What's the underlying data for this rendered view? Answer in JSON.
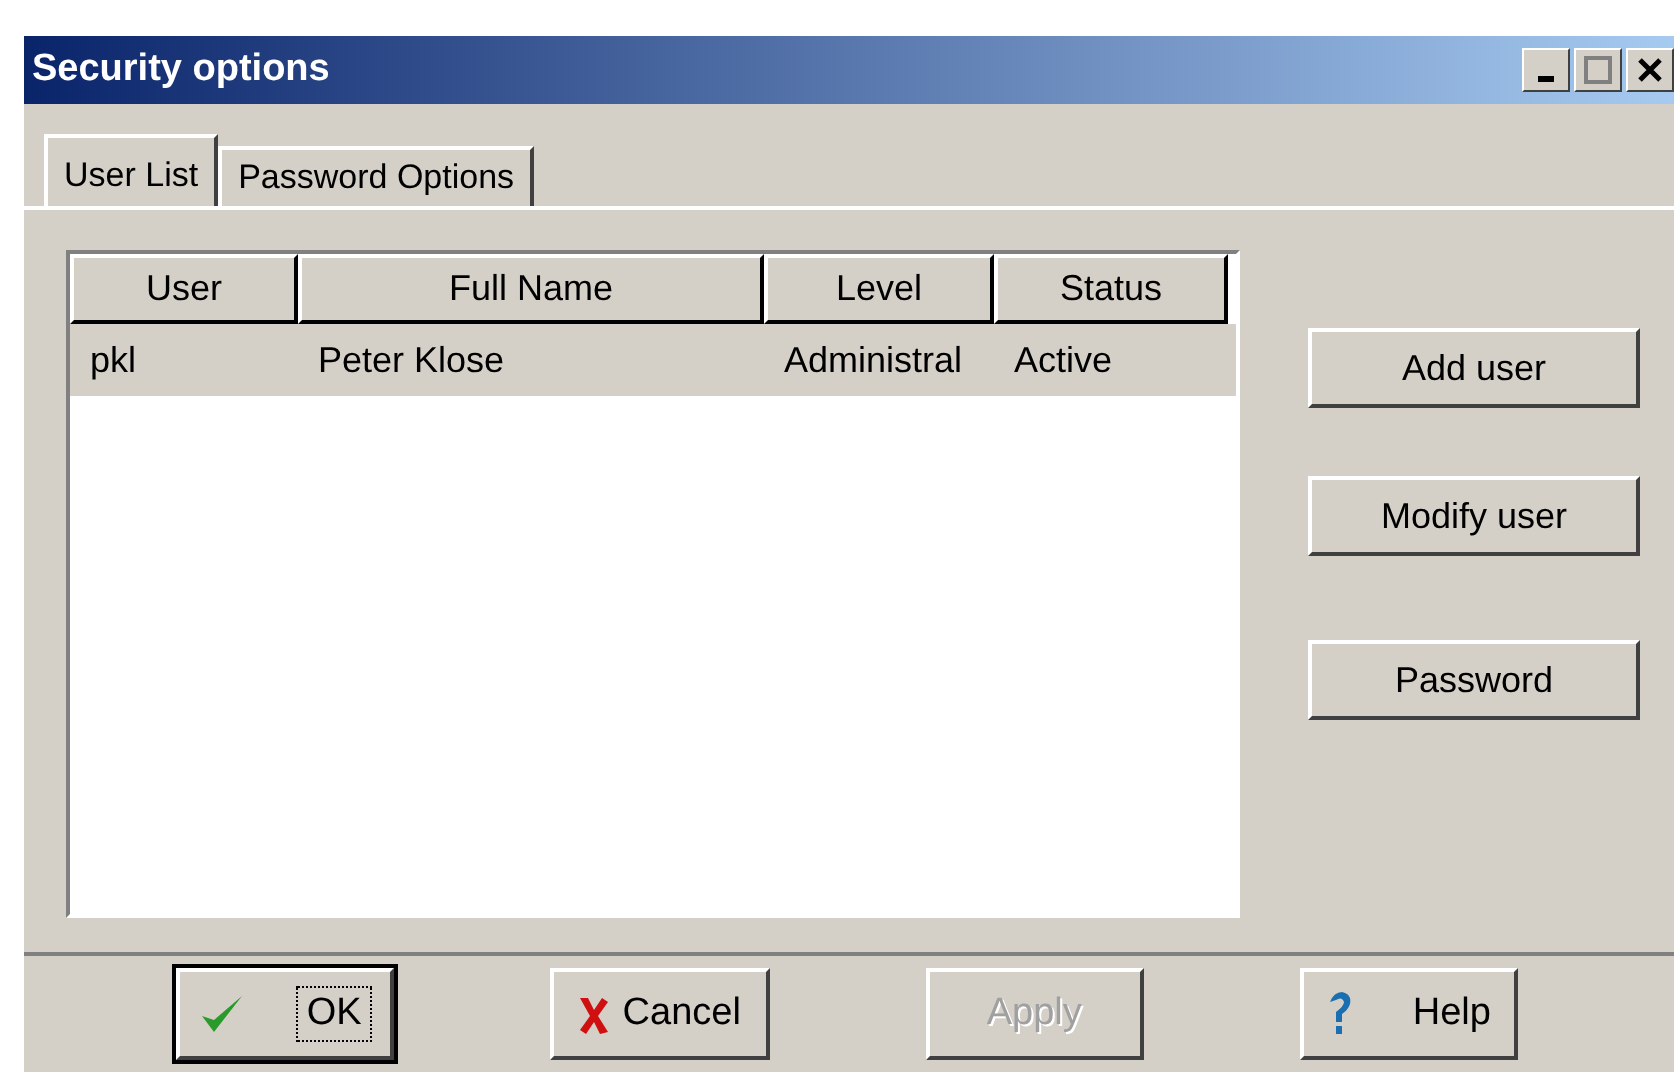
{
  "window": {
    "title": "Security options"
  },
  "tabs": [
    {
      "label": "User List",
      "selected": true
    },
    {
      "label": "Password Options",
      "selected": false
    }
  ],
  "table": {
    "columns": [
      "User",
      "Full Name",
      "Level",
      "Status"
    ],
    "rows": [
      {
        "cells": [
          "pkl",
          "Peter Klose",
          "Administral",
          "Active"
        ],
        "selected": true
      }
    ]
  },
  "side_buttons": [
    "Add user",
    "Modify user",
    "Password"
  ],
  "footer_buttons": [
    {
      "label": "OK",
      "kind": "check",
      "default": true,
      "disabled": false
    },
    {
      "label": "Cancel",
      "kind": "cross",
      "default": false,
      "disabled": false
    },
    {
      "label": "Apply",
      "kind": "plain",
      "default": false,
      "disabled": true
    },
    {
      "label": "Help",
      "kind": "question",
      "default": false,
      "disabled": false
    }
  ]
}
